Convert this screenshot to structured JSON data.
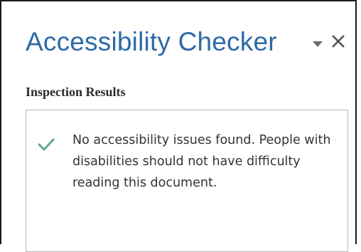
{
  "pane": {
    "title": "Accessibility Checker",
    "options_icon": "chevron-down-icon",
    "close_icon": "close-icon"
  },
  "inspection": {
    "heading": "Inspection Results",
    "status_icon": "checkmark-icon",
    "message": "No accessibility issues found. People with disabilities should not have difficulty reading this document."
  },
  "colors": {
    "title": "#2e6aa7",
    "checkmark": "#5fa892",
    "text": "#333333"
  }
}
